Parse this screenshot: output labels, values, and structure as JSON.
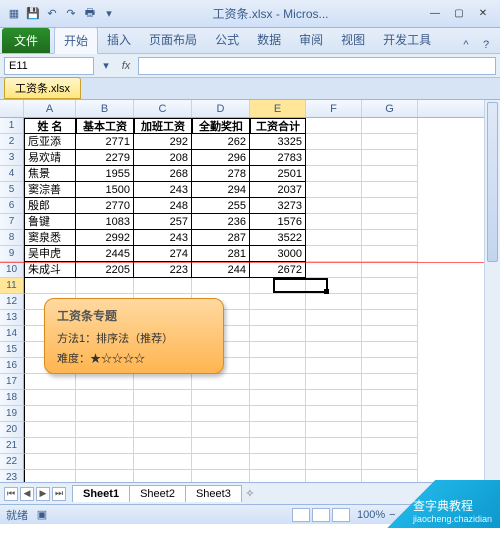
{
  "titlebar": {
    "title": "工资条.xlsx - Micros..."
  },
  "ribbon": {
    "file": "文件",
    "tabs": [
      "开始",
      "插入",
      "页面布局",
      "公式",
      "数据",
      "审阅",
      "视图",
      "开发工具"
    ]
  },
  "namebox": "E11",
  "fx_label": "fx",
  "workbook_tab": "工资条.xlsx",
  "columns": [
    "A",
    "B",
    "C",
    "D",
    "E",
    "F",
    "G"
  ],
  "headers": [
    "姓  名",
    "基本工资",
    "加班工资",
    "全勤奖扣",
    "工资合计"
  ],
  "rows": [
    {
      "n": "卮亚添",
      "v": [
        2771,
        292,
        262,
        3325
      ]
    },
    {
      "n": "易欢靖",
      "v": [
        2279,
        208,
        296,
        2783
      ]
    },
    {
      "n": "焦景",
      "v": [
        1955,
        268,
        278,
        2501
      ]
    },
    {
      "n": "窦淙善",
      "v": [
        1500,
        243,
        294,
        2037
      ]
    },
    {
      "n": "殷郎",
      "v": [
        2770,
        248,
        255,
        3273
      ]
    },
    {
      "n": "鲁键",
      "v": [
        1083,
        257,
        236,
        1576
      ]
    },
    {
      "n": "窦泉悉",
      "v": [
        2992,
        243,
        287,
        3522
      ]
    },
    {
      "n": "吴申虎",
      "v": [
        2445,
        274,
        281,
        3000
      ]
    },
    {
      "n": "朱成斗",
      "v": [
        2205,
        223,
        244,
        2672
      ]
    }
  ],
  "blank_rows": 13,
  "callout": {
    "title": "工资条专题",
    "method": "方法1：排序法（推荐）",
    "difficulty_label": "难度：",
    "stars": "★☆☆☆☆"
  },
  "sheets": {
    "tabs": [
      "Sheet1",
      "Sheet2",
      "Sheet3"
    ],
    "active": 0
  },
  "status": {
    "mode": "就绪",
    "zoom": "100%"
  },
  "watermark": {
    "line1": "查字典教程",
    "line2": "jiaocheng.chazidian"
  },
  "chart_data": {
    "type": "table",
    "title": "工资条",
    "columns": [
      "姓名",
      "基本工资",
      "加班工资",
      "全勤奖扣",
      "工资合计"
    ],
    "data": [
      [
        "卮亚添",
        2771,
        292,
        262,
        3325
      ],
      [
        "易欢靖",
        2279,
        208,
        296,
        2783
      ],
      [
        "焦景",
        1955,
        268,
        278,
        2501
      ],
      [
        "窦淙善",
        1500,
        243,
        294,
        2037
      ],
      [
        "殷郎",
        2770,
        248,
        255,
        3273
      ],
      [
        "鲁键",
        1083,
        257,
        236,
        1576
      ],
      [
        "窦泉悉",
        2992,
        243,
        287,
        3522
      ],
      [
        "吴申虎",
        2445,
        274,
        281,
        3000
      ],
      [
        "朱成斗",
        2205,
        223,
        244,
        2672
      ]
    ]
  }
}
